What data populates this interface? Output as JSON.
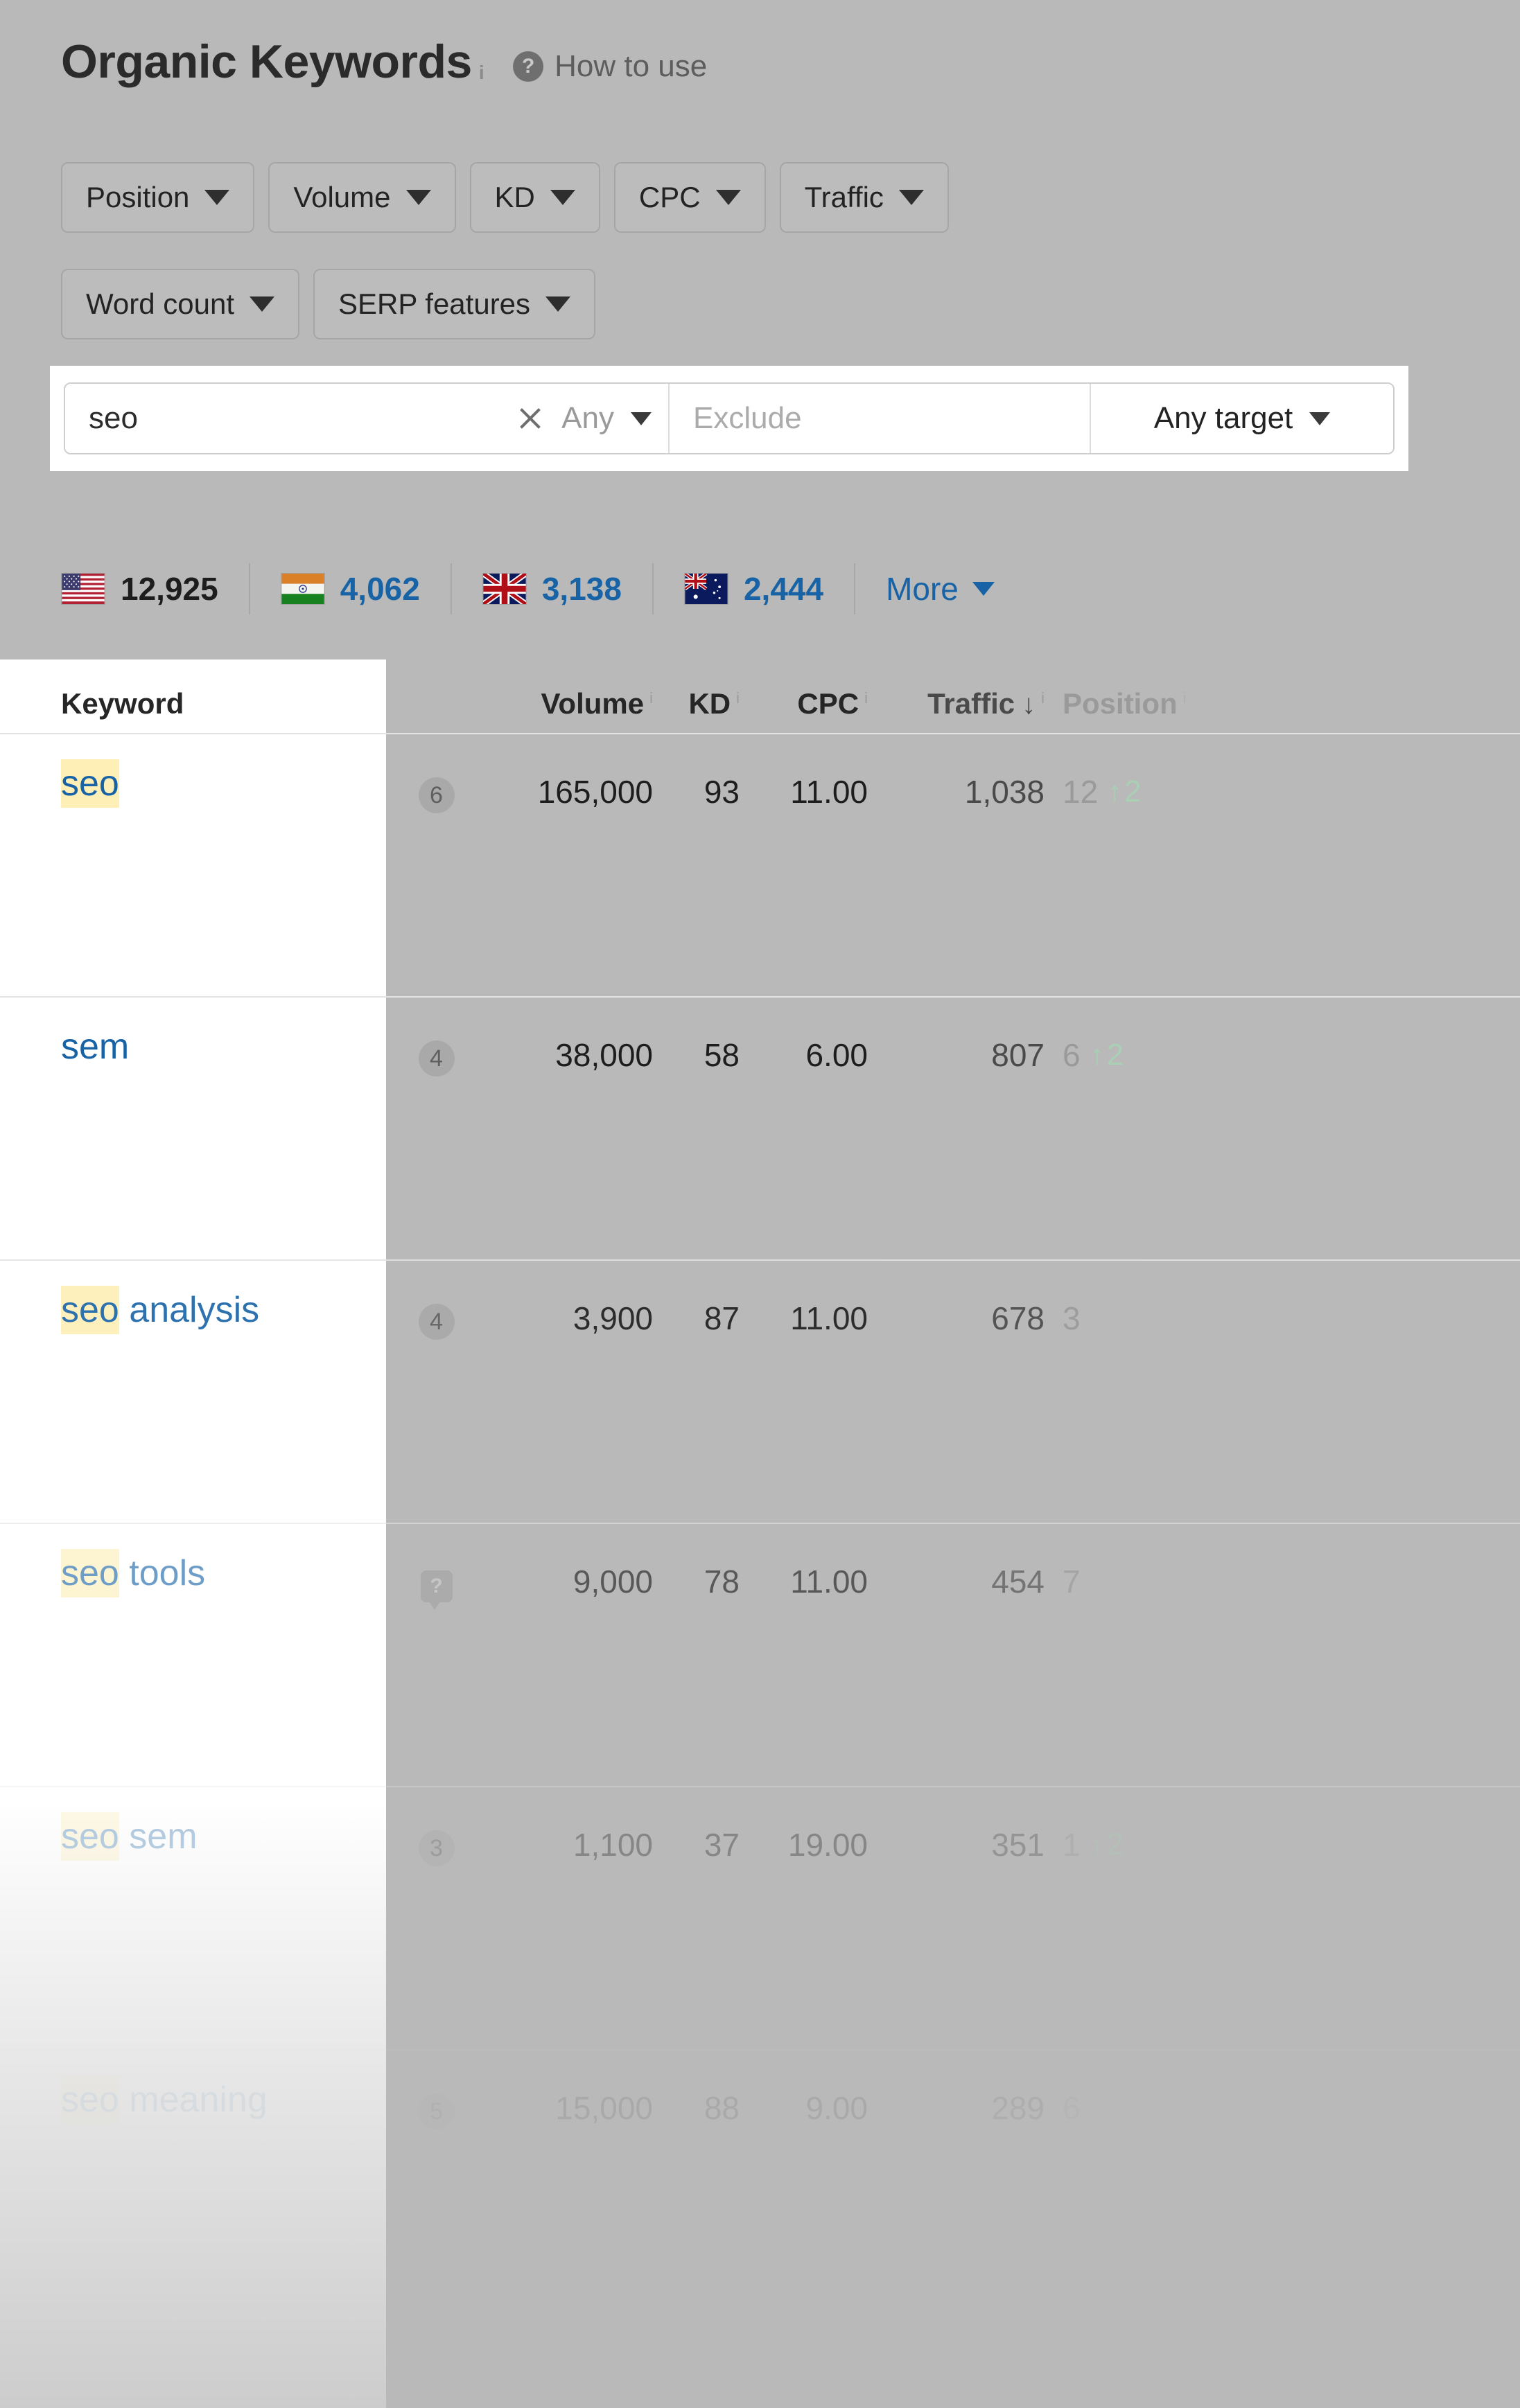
{
  "header": {
    "title": "Organic Keywords",
    "title_info": "i",
    "help_icon": "?",
    "help_label": "How to use"
  },
  "filters": {
    "row1": [
      {
        "label": "Position",
        "icon": "chevron-down-icon"
      },
      {
        "label": "Volume",
        "icon": "chevron-down-icon"
      },
      {
        "label": "KD",
        "icon": "chevron-down-icon"
      },
      {
        "label": "CPC",
        "icon": "chevron-down-icon"
      },
      {
        "label": "Traffic",
        "icon": "chevron-down-icon"
      }
    ],
    "row2": [
      {
        "label": "Word count",
        "icon": "chevron-down-icon"
      },
      {
        "label": "SERP features",
        "icon": "chevron-down-icon"
      }
    ]
  },
  "search": {
    "include_value": "seo",
    "clear_icon": "close-icon",
    "match_mode": "Any",
    "match_caret": "chevron-down-icon",
    "exclude_placeholder": "Exclude",
    "exclude_value": "",
    "target_label": "Any target",
    "target_caret": "chevron-down-icon"
  },
  "countries": [
    {
      "code": "US",
      "flag": "us-flag-icon",
      "count": "12,925",
      "active": true
    },
    {
      "code": "IN",
      "flag": "in-flag-icon",
      "count": "4,062",
      "active": false
    },
    {
      "code": "GB",
      "flag": "gb-flag-icon",
      "count": "3,138",
      "active": false
    },
    {
      "code": "AU",
      "flag": "au-flag-icon",
      "count": "2,444",
      "active": false
    }
  ],
  "more_label": "More",
  "table": {
    "columns": {
      "keyword": "Keyword",
      "volume": "Volume",
      "kd": "KD",
      "cpc": "CPC",
      "traffic": "Traffic",
      "position": "Position",
      "info_mark": "i",
      "sort_arrow": "↓"
    },
    "rows": [
      {
        "keyword_highlight": "seo",
        "keyword_rest": "",
        "badge": "6",
        "badge_type": "circle",
        "volume": "165,000",
        "kd": "93",
        "cpc": "11.00",
        "traffic": "1,038",
        "position": "12",
        "pos_delta": "2",
        "pos_delta_dir": "↑"
      },
      {
        "keyword_highlight": "",
        "keyword_rest": "sem",
        "badge": "4",
        "badge_type": "circle",
        "volume": "38,000",
        "kd": "58",
        "cpc": "6.00",
        "traffic": "807",
        "position": "6",
        "pos_delta": "2",
        "pos_delta_dir": "↑"
      },
      {
        "keyword_highlight": "seo",
        "keyword_rest": " analysis",
        "badge": "4",
        "badge_type": "circle",
        "volume": "3,900",
        "kd": "87",
        "cpc": "11.00",
        "traffic": "678",
        "position": "3",
        "pos_delta": "",
        "pos_delta_dir": ""
      },
      {
        "keyword_highlight": "seo",
        "keyword_rest": " tools",
        "badge": "?",
        "badge_type": "serp-feature",
        "volume": "9,000",
        "kd": "78",
        "cpc": "11.00",
        "traffic": "454",
        "position": "7",
        "pos_delta": "",
        "pos_delta_dir": ""
      },
      {
        "keyword_highlight": "seo",
        "keyword_rest": " sem",
        "badge": "3",
        "badge_type": "circle",
        "volume": "1,100",
        "kd": "37",
        "cpc": "19.00",
        "traffic": "351",
        "position": "1",
        "pos_delta": "2",
        "pos_delta_dir": "↑"
      },
      {
        "keyword_highlight": "seo",
        "keyword_rest": " meaning",
        "badge": "5",
        "badge_type": "circle",
        "volume": "15,000",
        "kd": "88",
        "cpc": "9.00",
        "traffic": "289",
        "position": "6",
        "pos_delta": "",
        "pos_delta_dir": ""
      }
    ]
  }
}
